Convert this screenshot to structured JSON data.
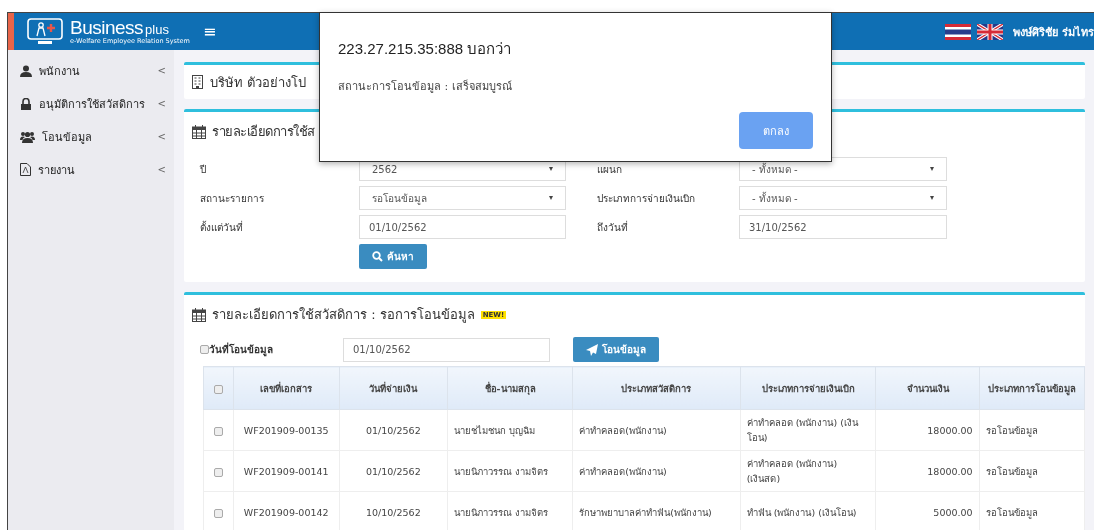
{
  "topbar": {
    "brand": "Business",
    "brand_suffix": "plus",
    "tagline": "e-Welfare Employee Relation System",
    "menu_glyph": "≡",
    "user": "พงษ์ศิริชัย ร่มไทร"
  },
  "sidebar": {
    "items": [
      {
        "label": "พนักงาน",
        "chevron": "<"
      },
      {
        "label": "อนุมัติการใช้สวัสดิการ",
        "chevron": "<"
      },
      {
        "label": "โอนข้อมูล",
        "chevron": "<"
      },
      {
        "label": "รายงาน",
        "chevron": "<"
      }
    ]
  },
  "company_panel": {
    "title": "บริษัท ตัวอย่างโป"
  },
  "filter_panel": {
    "title": "รายละเอียดการใช้ส",
    "fields": [
      {
        "label": "ปี",
        "kind": "select",
        "value": "2562"
      },
      {
        "label": "แผนก",
        "kind": "select",
        "value": "- ทั้งหมด -"
      },
      {
        "label": "สถานะรายการ",
        "kind": "select",
        "value": "รอโอนข้อมูล"
      },
      {
        "label": "ประเภทการจ่ายเงินเบิก",
        "kind": "select",
        "value": "- ทั้งหมด -"
      },
      {
        "label": "ตั้งแต่วันที่",
        "kind": "input",
        "value": "01/10/2562"
      },
      {
        "label": "ถึงวันที่",
        "kind": "input",
        "value": "31/10/2562"
      }
    ],
    "search_button": "ค้นหา"
  },
  "list_panel": {
    "title": "รายละเอียดการใช้สวัสดิการ : รอการโอนข้อมูล",
    "badge": "NEW!",
    "transfer_date": {
      "label": "วันที่โอนข้อมูล",
      "checked": false,
      "value": "01/10/2562"
    },
    "transfer_button": "โอนข้อมูล",
    "table": {
      "all_checked": false,
      "columns": [
        "เลขที่เอกสาร",
        "วันที่จ่ายเงิน",
        "ชื่อ-นามสกุล",
        "ประเภทสวัสดิการ",
        "ประเภทการจ่ายเงินเบิก",
        "จำนวนเงิน",
        "ประเภทการโอนข้อมูล"
      ],
      "rows": [
        {
          "checked": false,
          "cells": [
            "WF201909-00135",
            "01/10/2562",
            "นายชไมชนก บุญฉิม",
            "ค่าทำคลอด(พนักงาน)",
            "ค่าทำคลอด (พนักงาน) (เงินโอน)",
            "18000.00",
            "รอโอนข้อมูล"
          ]
        },
        {
          "checked": false,
          "cells": [
            "WF201909-00141",
            "01/10/2562",
            "นายนิภาวรรณ งามจิตร",
            "ค่าทำคลอด(พนักงาน)",
            "ค่าทำคลอด (พนักงาน) (เงินสด)",
            "18000.00",
            "รอโอนข้อมูล"
          ]
        },
        {
          "checked": false,
          "cells": [
            "WF201909-00142",
            "10/10/2562",
            "นายนิภาวรรณ งามจิตร",
            "รักษาพยาบาลค่าทำฟัน(พนักงาน)",
            "ทำฟัน (พนักงาน) (เงินโอน)",
            "5000.00",
            "รอโอนข้อมูล"
          ]
        }
      ]
    }
  },
  "dialog": {
    "title": "223.27.215.35:888 บอกว่า",
    "message": "สถานะการโอนข้อมูล : เสร็จสมบูรณ์",
    "ok_button": "ตกลง"
  }
}
